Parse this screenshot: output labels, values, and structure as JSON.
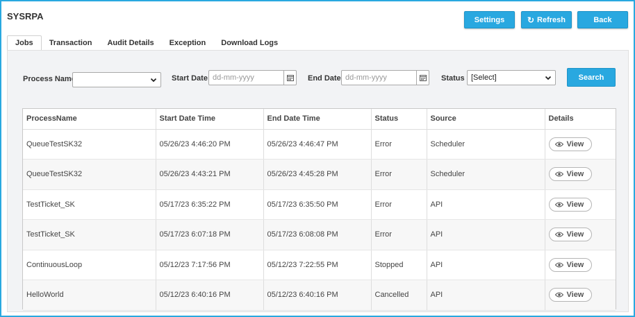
{
  "app": {
    "title": "SYSRPA"
  },
  "header": {
    "settings_label": "Settings",
    "refresh_label": "Refresh",
    "back_label": "Back"
  },
  "tabs": [
    {
      "label": "Jobs",
      "active": true
    },
    {
      "label": "Transaction",
      "active": false
    },
    {
      "label": "Audit Details",
      "active": false
    },
    {
      "label": "Exception",
      "active": false
    },
    {
      "label": "Download Logs",
      "active": false
    }
  ],
  "filters": {
    "process_name_label": "Process Name :",
    "process_name_value": "",
    "start_date_label": "Start Date :",
    "start_date_placeholder": "dd-mm-yyyy",
    "end_date_label": "End Date :",
    "end_date_placeholder": "dd-mm-yyyy",
    "status_label": "Status :",
    "status_value": "[Select]",
    "search_label": "Search"
  },
  "table": {
    "columns": [
      "ProcessName",
      "Start Date Time",
      "End Date Time",
      "Status",
      "Source",
      "Details"
    ],
    "view_label": "View",
    "rows": [
      {
        "process": "QueueTestSK32",
        "start": "05/26/23 4:46:20 PM",
        "end": "05/26/23 4:46:47 PM",
        "status": "Error",
        "source": "Scheduler"
      },
      {
        "process": "QueueTestSK32",
        "start": "05/26/23 4:43:21 PM",
        "end": "05/26/23 4:45:28 PM",
        "status": "Error",
        "source": "Scheduler"
      },
      {
        "process": "TestTicket_SK",
        "start": "05/17/23 6:35:22 PM",
        "end": "05/17/23 6:35:50 PM",
        "status": "Error",
        "source": "API"
      },
      {
        "process": "TestTicket_SK",
        "start": "05/17/23 6:07:18 PM",
        "end": "05/17/23 6:08:08 PM",
        "status": "Error",
        "source": "API"
      },
      {
        "process": "ContinuousLoop",
        "start": "05/12/23 7:17:56 PM",
        "end": "05/12/23 7:22:55 PM",
        "status": "Stopped",
        "source": "API"
      },
      {
        "process": "HelloWorld",
        "start": "05/12/23 6:40:16 PM",
        "end": "05/12/23 6:40:16 PM",
        "status": "Cancelled",
        "source": "API"
      }
    ]
  },
  "colors": {
    "accent": "#29a8e0",
    "frame": "#29a8e0",
    "content_bg": "#f2f3f5"
  },
  "icons": {
    "refresh": "refresh-icon",
    "calendar": "calendar-icon",
    "dropdown": "chevron-down-icon",
    "view": "eye-icon"
  }
}
